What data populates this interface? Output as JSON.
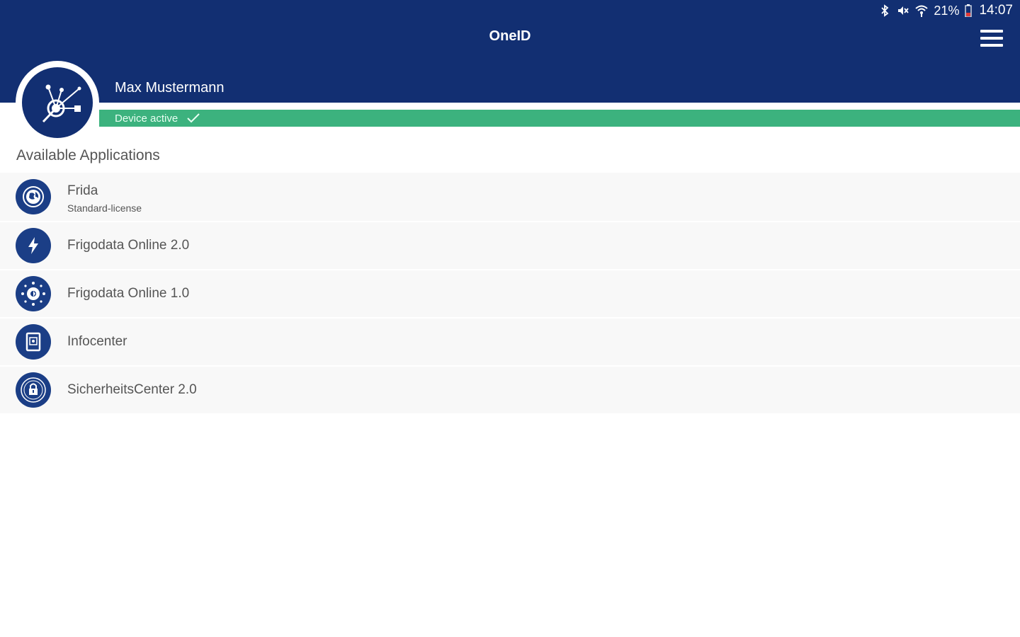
{
  "status_bar": {
    "icons": [
      "bluetooth-icon",
      "mute-icon",
      "wifi-icon",
      "battery-icon"
    ],
    "battery": "21%",
    "time": "14:07"
  },
  "header": {
    "title": "OneID",
    "menu_icon": "hamburger-menu-icon"
  },
  "user": {
    "name": "Max Mustermann",
    "avatar_icon": "network-hub-icon",
    "device_status": "Device active",
    "device_status_icon": "checkmark-icon"
  },
  "applications": {
    "section_title": "Available Applications",
    "items": [
      {
        "name": "Frida",
        "subtitle": "Standard-license",
        "icon": "globe-icon"
      },
      {
        "name": "Frigodata Online 2.0",
        "icon": "lightning-icon"
      },
      {
        "name": "Frigodata Online 1.0",
        "icon": "compass-icon"
      },
      {
        "name": "Infocenter",
        "icon": "document-icon"
      },
      {
        "name": "SicherheitsCenter 2.0",
        "icon": "lock-icon"
      }
    ]
  },
  "colors": {
    "header_bg": "#122f72",
    "device_active": "#3cb27e",
    "icon_bg": "#1b3e86",
    "list_bg": "#f8f8f8",
    "text": "#555555"
  }
}
